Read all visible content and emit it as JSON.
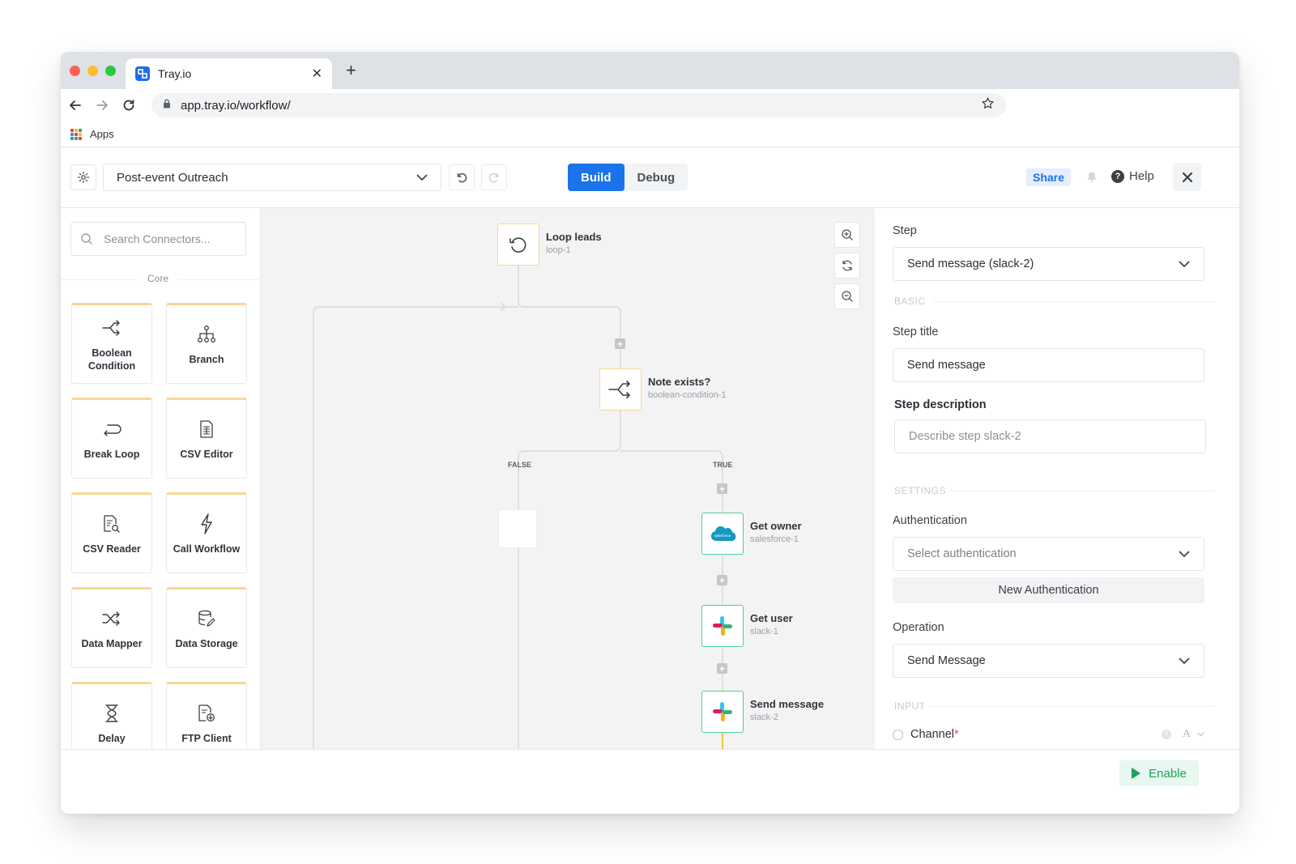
{
  "browser": {
    "tab_title": "Tray.io",
    "url": "app.tray.io/workflow/",
    "bookmarks": {
      "apps_label": "Apps"
    }
  },
  "header": {
    "workflow_name": "Post-event Outreach",
    "modes": {
      "build": "Build",
      "debug": "Debug"
    },
    "share_label": "Share",
    "help_label": "Help"
  },
  "sidebar": {
    "search_placeholder": "Search Connectors...",
    "section_label": "Core",
    "connectors": [
      {
        "label": "Boolean Condition",
        "icon": "boolean-icon"
      },
      {
        "label": "Branch",
        "icon": "branch-icon"
      },
      {
        "label": "Break Loop",
        "icon": "break-loop-icon"
      },
      {
        "label": "CSV Editor",
        "icon": "csv-editor-icon"
      },
      {
        "label": "CSV Reader",
        "icon": "csv-reader-icon"
      },
      {
        "label": "Call Workflow",
        "icon": "lightning-icon"
      },
      {
        "label": "Data Mapper",
        "icon": "shuffle-icon"
      },
      {
        "label": "Data Storage",
        "icon": "database-icon"
      },
      {
        "label": "Delay",
        "icon": "hourglass-icon"
      },
      {
        "label": "FTP Client",
        "icon": "ftp-icon"
      }
    ]
  },
  "canvas": {
    "nodes": {
      "loop": {
        "title": "Loop leads",
        "id": "loop-1"
      },
      "condition": {
        "title": "Note exists?",
        "id": "boolean-condition-1"
      },
      "get_owner": {
        "title": "Get owner",
        "id": "salesforce-1"
      },
      "get_user": {
        "title": "Get user",
        "id": "slack-1"
      },
      "send_message": {
        "title": "Send message",
        "id": "slack-2"
      }
    },
    "branch_false": "FALSE",
    "branch_true": "TRUE"
  },
  "properties": {
    "step_label": "Step",
    "step_value": "Send message (slack-2)",
    "basic_section": "BASIC",
    "step_title_label": "Step title",
    "step_title_value": "Send message",
    "step_description_label": "Step description",
    "step_description_placeholder": "Describe step slack-2",
    "settings_section": "SETTINGS",
    "authentication_label": "Authentication",
    "authentication_placeholder": "Select authentication",
    "new_auth_label": "New Authentication",
    "operation_label": "Operation",
    "operation_value": "Send Message",
    "input_section": "INPUT",
    "channel_label": "Channel",
    "required_marker": "*",
    "text_type_symbol": "A"
  },
  "footer": {
    "enable_label": "Enable"
  },
  "colors": {
    "primary": "#1a73e8",
    "core_accent": "#f6d98f",
    "connector_accent": "#4fcf9a",
    "enable_green": "#1aa35a",
    "flow_highlight": "#f2c33c"
  }
}
